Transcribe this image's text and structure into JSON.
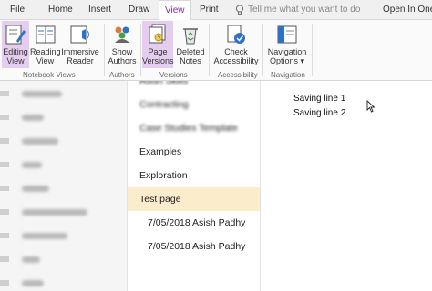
{
  "menu": {
    "tabs": [
      "File",
      "Home",
      "Insert",
      "Draw",
      "View",
      "Print"
    ],
    "tell_me_placeholder": "Tell me what you want to do",
    "open_in": "Open In One"
  },
  "ribbon": {
    "buttons": [
      {
        "line1": "Editing",
        "line2": "View"
      },
      {
        "line1": "Reading",
        "line2": "View"
      },
      {
        "line1": "Immersive",
        "line2": "Reader"
      },
      {
        "line1": "Show",
        "line2": "Authors"
      },
      {
        "line1": "Page",
        "line2": "Versions"
      },
      {
        "line1": "Deleted",
        "line2": "Notes"
      },
      {
        "line1": "Check",
        "line2": "Accessibility"
      },
      {
        "line1": "Navigation",
        "line2": "Options ▾"
      }
    ],
    "groups": [
      "Notebook Views",
      "Authors",
      "Versions",
      "Accessibility",
      "Navigation"
    ]
  },
  "pages": {
    "items": [
      "Asish Skills",
      "Contracting",
      "Case Studies Template",
      "Examples",
      "Exploration",
      "Test page",
      "7/05/2018 Asish Padhy",
      "7/05/2018 Asish Padhy"
    ]
  },
  "note": {
    "lines": [
      "Saving line 1",
      "Saving line 2"
    ]
  },
  "colors": {
    "accent": "#7b2f9c",
    "active_button": "#e4cdee",
    "selected_page": "#fbeccb"
  }
}
